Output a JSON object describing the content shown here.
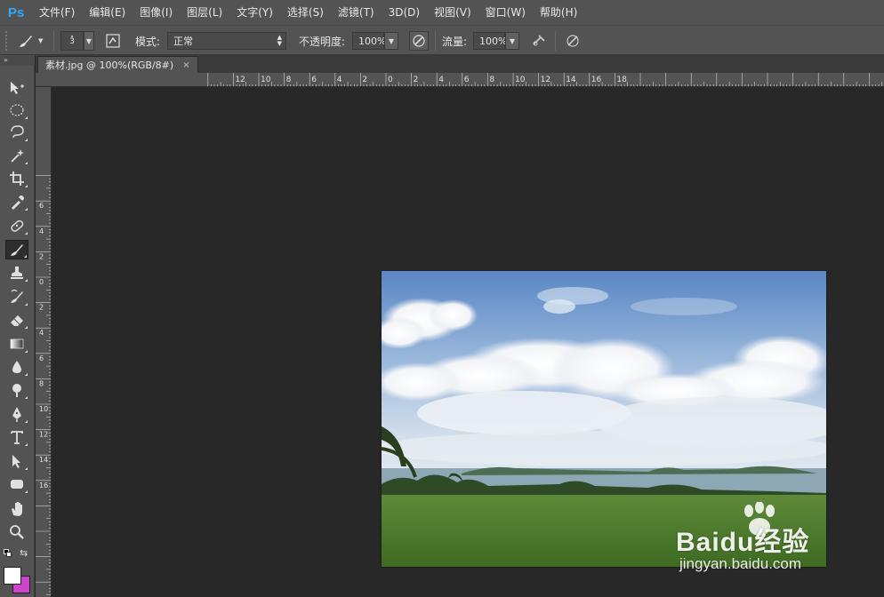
{
  "app": {
    "logo": "Ps"
  },
  "menu": [
    "文件(F)",
    "编辑(E)",
    "图像(I)",
    "图层(L)",
    "文字(Y)",
    "选择(S)",
    "滤镜(T)",
    "3D(D)",
    "视图(V)",
    "窗口(W)",
    "帮助(H)"
  ],
  "options": {
    "brush_size": "3",
    "mode_label": "模式:",
    "mode_value": "正常",
    "opacity_label": "不透明度:",
    "opacity_value": "100%",
    "flow_label": "流量:",
    "flow_value": "100%"
  },
  "document": {
    "tab_title": "素材.jpg @ 100%(RGB/8#)",
    "close_glyph": "×"
  },
  "rulers": {
    "h_labels": [
      "12",
      "10",
      "8",
      "6",
      "4",
      "2",
      "0",
      "2",
      "4",
      "6",
      "8",
      "10",
      "12",
      "14",
      "16",
      "18"
    ],
    "v_labels": [
      "6",
      "4",
      "2",
      "0",
      "2",
      "4",
      "6",
      "8",
      "10",
      "12",
      "14",
      "16"
    ]
  },
  "tools": [
    "move-tool",
    "marquee-tool",
    "lasso-tool",
    "magic-wand-tool",
    "crop-tool",
    "eyedropper-tool",
    "healing-brush-tool",
    "brush-tool",
    "clone-stamp-tool",
    "history-brush-tool",
    "eraser-tool",
    "gradient-tool",
    "blur-tool",
    "dodge-tool",
    "pen-tool",
    "type-tool",
    "path-selection-tool",
    "rectangle-tool",
    "hand-tool",
    "zoom-tool"
  ],
  "colors": {
    "foreground": "#ffffff",
    "background": "#cc44cc",
    "accent": "#31a8ff"
  },
  "watermark": {
    "brand": "Baidu经验",
    "url": "jingyan.baidu.com"
  }
}
